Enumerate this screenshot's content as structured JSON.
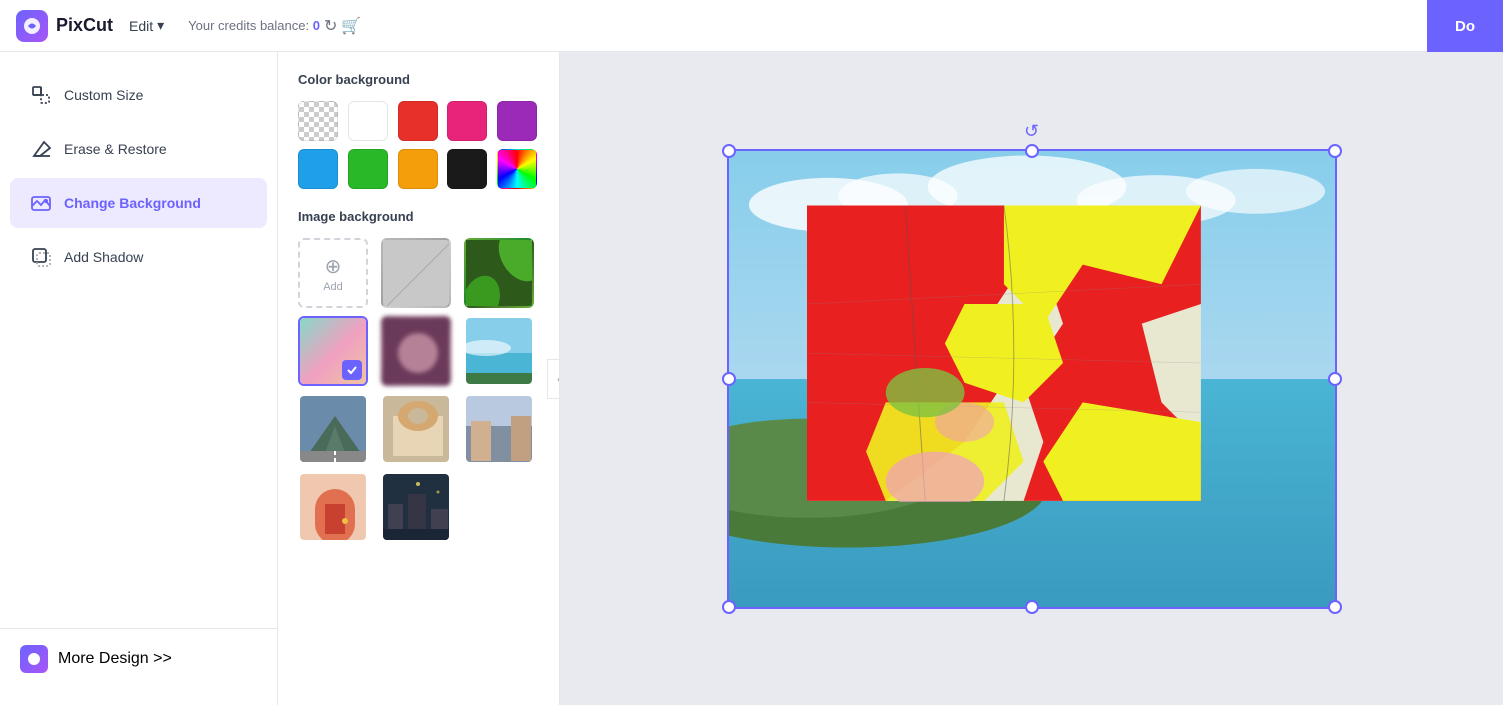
{
  "header": {
    "logo_text": "PixCut",
    "edit_menu_label": "Edit",
    "credits_label": "Your credits balance:",
    "credits_value": "0",
    "done_button_label": "Do"
  },
  "sidebar": {
    "items": [
      {
        "id": "custom-size",
        "label": "Custom Size",
        "icon": "crop-icon"
      },
      {
        "id": "erase-restore",
        "label": "Erase & Restore",
        "icon": "eraser-icon"
      },
      {
        "id": "change-background",
        "label": "Change Background",
        "icon": "background-icon",
        "active": true
      },
      {
        "id": "add-shadow",
        "label": "Add Shadow",
        "icon": "shadow-icon"
      }
    ],
    "bottom": {
      "label": "More Design >>",
      "icon": "design-icon"
    }
  },
  "panel": {
    "color_bg_title": "Color background",
    "image_bg_title": "Image background",
    "colors": [
      {
        "id": "transparent",
        "type": "transparent"
      },
      {
        "id": "white",
        "hex": "#ffffff"
      },
      {
        "id": "red",
        "hex": "#e8302a"
      },
      {
        "id": "pink",
        "hex": "#e8247a"
      },
      {
        "id": "purple",
        "hex": "#9b2ab8"
      },
      {
        "id": "blue",
        "hex": "#1e9fe8"
      },
      {
        "id": "green",
        "hex": "#28b828"
      },
      {
        "id": "orange",
        "hex": "#f59e0b"
      },
      {
        "id": "black",
        "hex": "#1a1a1a"
      },
      {
        "id": "rainbow",
        "type": "rainbow"
      }
    ],
    "add_label": "Add"
  }
}
